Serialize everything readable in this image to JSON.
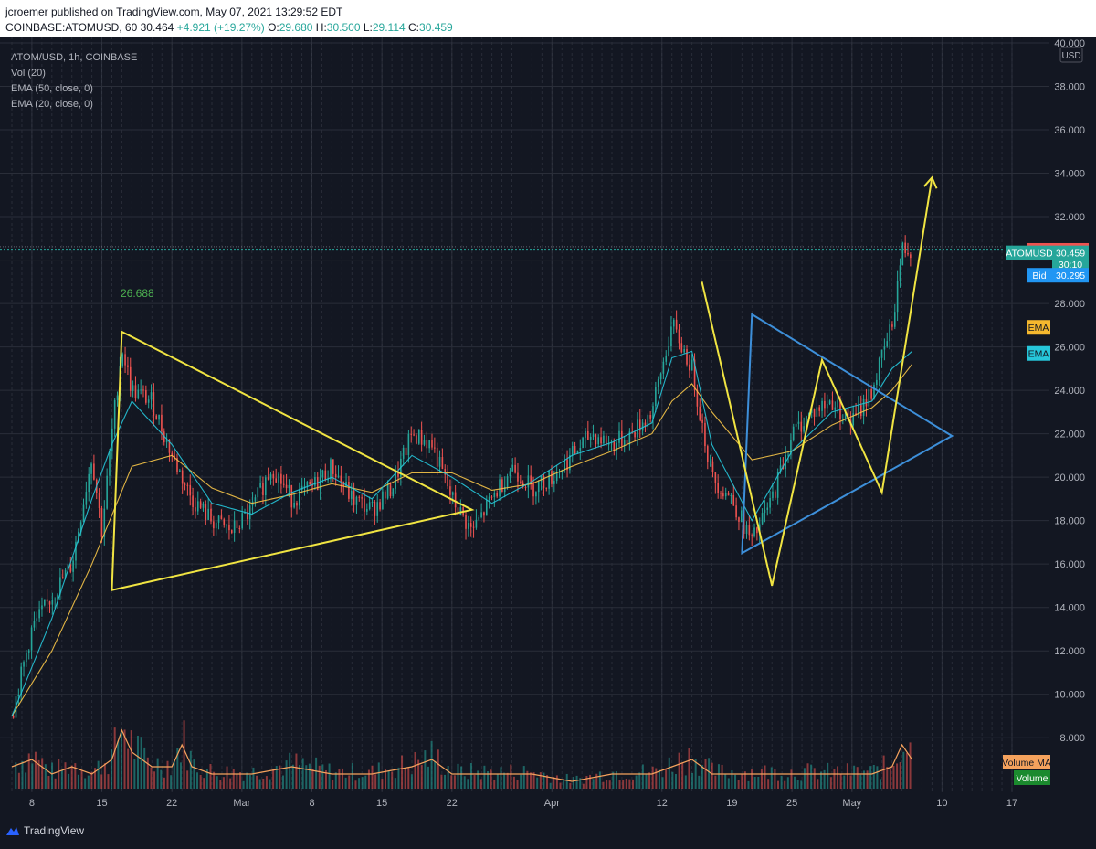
{
  "header": {
    "published_line": "jcroemer published on TradingView.com, May 07, 2021 13:29:52 EDT",
    "symbol_line": "COINBASE:ATOMUSD, 60",
    "last_price": "30.464",
    "change": "+4.921 (+19.27%)",
    "open_label": "O:",
    "open": "29.680",
    "high_label": "H:",
    "high": "30.500",
    "low_label": "L:",
    "low": "29.114",
    "close_label": "C:",
    "close": "30.459"
  },
  "legend": {
    "title": "ATOM/USD, 1h, COINBASE",
    "vol": "Vol (20)",
    "ema50": "EMA (50, close, 0)",
    "ema20": "EMA (20, close, 0)"
  },
  "footer": {
    "brand": "TradingView"
  },
  "colors": {
    "background": "#131722",
    "grid": "#363a45",
    "price_up": "#26a69a",
    "price_down": "#ef5350",
    "ema_fast": "#26c6da",
    "ema_slow": "#f7c548",
    "drawing_yellow": "#f0e442",
    "drawing_blue": "#3d8fd9",
    "volume_ma": "#f5a25d",
    "ask": "#ef5350",
    "bid": "#2196f3"
  },
  "chart_data": {
    "type": "line",
    "title": "ATOM/USD, 1h, COINBASE",
    "ylim": [
      7,
      40
    ],
    "y_ticks": [
      8,
      10,
      12,
      14,
      16,
      18,
      20,
      22,
      24,
      26,
      28,
      30,
      32,
      34,
      36,
      38,
      40
    ],
    "y_tick_labels": [
      "8.000",
      "10.000",
      "12.000",
      "14.000",
      "16.000",
      "18.000",
      "20.000",
      "22.000",
      "24.000",
      "26.000",
      "28.000",
      "30.000",
      "32.000",
      "34.000",
      "36.000",
      "38.000",
      "40.000"
    ],
    "currency": "USD",
    "x_axis_day_range": [
      0,
      100
    ],
    "x_ticks": [
      {
        "day": 2,
        "label": "8"
      },
      {
        "day": 9,
        "label": "15"
      },
      {
        "day": 16,
        "label": "22"
      },
      {
        "day": 23,
        "label": "Mar"
      },
      {
        "day": 30,
        "label": "8"
      },
      {
        "day": 37,
        "label": "15"
      },
      {
        "day": 44,
        "label": "22"
      },
      {
        "day": 54,
        "label": "Apr"
      },
      {
        "day": 65,
        "label": "12"
      },
      {
        "day": 72,
        "label": "19"
      },
      {
        "day": 78,
        "label": "25"
      },
      {
        "day": 84,
        "label": "May"
      },
      {
        "day": 93,
        "label": "10"
      },
      {
        "day": 100,
        "label": "17"
      }
    ],
    "price_series": {
      "name": "ATOMUSD",
      "day": [
        0,
        2,
        4,
        6,
        8,
        9,
        10,
        11,
        12,
        14,
        16,
        18,
        20,
        22,
        24,
        26,
        28,
        30,
        32,
        34,
        36,
        38,
        40,
        42,
        44,
        46,
        48,
        50,
        52,
        54,
        56,
        58,
        60,
        62,
        64,
        66,
        67,
        68,
        70,
        72,
        74,
        76,
        78,
        80,
        82,
        84,
        86,
        87,
        88,
        89,
        90
      ],
      "close": [
        9.0,
        13.0,
        14.5,
        16.0,
        21.0,
        17.5,
        22.0,
        26.0,
        24.0,
        23.5,
        21.0,
        19.0,
        18.0,
        17.5,
        18.5,
        20.5,
        19.0,
        19.5,
        20.5,
        19.0,
        18.5,
        19.5,
        22.0,
        21.5,
        19.0,
        17.5,
        19.0,
        20.5,
        19.5,
        20.0,
        21.0,
        22.0,
        21.5,
        22.0,
        23.0,
        27.0,
        26.0,
        25.0,
        20.0,
        19.0,
        17.0,
        19.0,
        22.0,
        23.0,
        23.5,
        22.5,
        24.0,
        25.5,
        27.0,
        30.5,
        30.459
      ]
    },
    "ema_fast": {
      "name": "EMA (20, close, 0)",
      "day": [
        0,
        4,
        8,
        10,
        12,
        16,
        20,
        24,
        28,
        32,
        36,
        40,
        44,
        48,
        52,
        56,
        60,
        64,
        66,
        68,
        70,
        74,
        78,
        82,
        86,
        88,
        90
      ],
      "value": [
        9.0,
        13.5,
        19.0,
        21.5,
        23.5,
        21.5,
        18.8,
        18.3,
        19.3,
        20.0,
        19.0,
        21.0,
        20.0,
        18.8,
        19.8,
        21.0,
        21.6,
        22.5,
        25.5,
        25.8,
        21.5,
        18.0,
        21.2,
        23.0,
        23.5,
        25.0,
        25.8
      ]
    },
    "ema_slow": {
      "name": "EMA (50, close, 0)",
      "day": [
        0,
        4,
        8,
        12,
        16,
        20,
        24,
        28,
        32,
        36,
        40,
        44,
        48,
        52,
        56,
        60,
        64,
        66,
        68,
        70,
        74,
        78,
        82,
        86,
        88,
        90
      ],
      "value": [
        9.0,
        12.0,
        16.0,
        20.5,
        21.0,
        19.5,
        18.8,
        19.2,
        19.7,
        19.3,
        20.2,
        20.2,
        19.4,
        19.7,
        20.5,
        21.2,
        22.0,
        23.5,
        24.3,
        23.0,
        20.8,
        21.2,
        22.4,
        23.2,
        24.0,
        25.2
      ]
    },
    "volume_ma": {
      "name": "Volume MA",
      "day": [
        0,
        2,
        4,
        6,
        8,
        10,
        11,
        12,
        14,
        16,
        17,
        18,
        20,
        24,
        28,
        32,
        36,
        40,
        42,
        44,
        48,
        52,
        56,
        60,
        64,
        66,
        68,
        70,
        74,
        78,
        82,
        86,
        88,
        89,
        90
      ],
      "value": [
        3,
        4,
        2,
        3,
        2,
        4,
        8,
        5,
        3,
        3,
        6,
        3,
        2,
        2,
        3,
        2,
        2,
        3,
        4,
        2,
        2,
        2,
        1,
        2,
        2,
        3,
        4,
        2,
        2,
        2,
        2,
        2,
        3,
        6,
        4
      ]
    },
    "current_price": "30.459",
    "price_labels": [
      {
        "label": "Ask",
        "value": "30.488",
        "price": 30.488
      },
      {
        "label": "ATOMUSD",
        "value": "30.459",
        "price": 30.459
      },
      {
        "label": "",
        "value": "30:10",
        "price": 29.9
      },
      {
        "label": "Bid",
        "value": "30.295",
        "price": 29.3
      }
    ],
    "ema_labels": [
      {
        "label": "EMA",
        "price": 26.9
      },
      {
        "label": "EMA",
        "price": 25.7
      }
    ],
    "volume_labels": [
      {
        "label": "Volume MA"
      },
      {
        "label": "Volume"
      }
    ],
    "annotation_value": "26.688",
    "drawings": {
      "yellow_triangle": [
        [
          11,
          26.7
        ],
        [
          46,
          18.5
        ],
        [
          10,
          14.8
        ]
      ],
      "blue_triangle": [
        [
          74,
          27.5
        ],
        [
          94,
          21.9
        ],
        [
          73,
          16.5
        ]
      ],
      "yellow_zigzag": [
        [
          69,
          29.0
        ],
        [
          76,
          15.0
        ],
        [
          81,
          25.4
        ],
        [
          87,
          19.3
        ],
        [
          92,
          33.8
        ]
      ]
    }
  }
}
